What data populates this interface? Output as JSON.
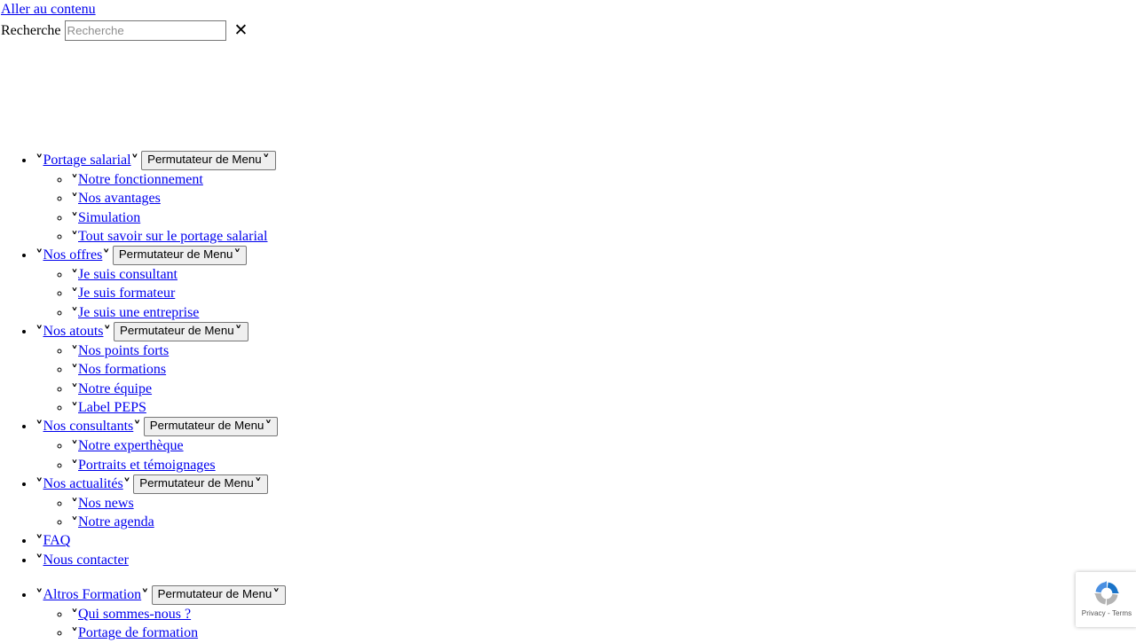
{
  "page": {
    "language": "fr",
    "skip_link": "Aller au contenu",
    "toggle_label": "Permutateur de Menu",
    "chevron_glyph": "˅",
    "close_glyph": "✕"
  },
  "colors": {
    "link": "#0000ee",
    "text": "#000000",
    "background": "#ffffff",
    "button_bg": "#efefef",
    "button_border": "#767676",
    "input_border": "#767676",
    "placeholder": "#8e8e8e"
  },
  "search": {
    "label": "Recherche",
    "placeholder": "Recherche",
    "value": "",
    "close_button_name": "Fermer"
  },
  "nav": {
    "primary": [
      {
        "label": "Portage salarial",
        "has_toggle": true,
        "children": [
          {
            "label": "Notre fonctionnement"
          },
          {
            "label": "Nos avantages"
          },
          {
            "label": "Simulation"
          },
          {
            "label": "Tout savoir sur le portage salarial"
          }
        ]
      },
      {
        "label": "Nos offres",
        "has_toggle": true,
        "children": [
          {
            "label": "Je suis consultant"
          },
          {
            "label": "Je suis formateur"
          },
          {
            "label": "Je suis une entreprise"
          }
        ]
      },
      {
        "label": "Nos atouts",
        "has_toggle": true,
        "children": [
          {
            "label": "Nos points forts"
          },
          {
            "label": "Nos formations"
          },
          {
            "label": "Notre équipe"
          },
          {
            "label": "Label PEPS"
          }
        ]
      },
      {
        "label": "Nos consultants",
        "has_toggle": true,
        "children": [
          {
            "label": "Notre experthèque"
          },
          {
            "label": "Portraits et témoignages"
          }
        ]
      },
      {
        "label": "Nos actualités",
        "has_toggle": true,
        "children": [
          {
            "label": "Nos news"
          },
          {
            "label": "Notre agenda"
          }
        ]
      },
      {
        "label": "FAQ",
        "has_toggle": false,
        "children": []
      },
      {
        "label": "Nous contacter",
        "has_toggle": false,
        "children": []
      }
    ],
    "secondary": [
      {
        "label": "Altros Formation",
        "has_toggle": true,
        "children": [
          {
            "label": "Qui sommes-nous ?"
          },
          {
            "label": "Portage de formation"
          }
        ]
      }
    ]
  },
  "recaptcha": {
    "privacy_terms": "Privacy - Terms",
    "logo_blue_light": "#4a90e2",
    "logo_blue_dark": "#1a73c8",
    "logo_grey": "#b4b4b4"
  }
}
